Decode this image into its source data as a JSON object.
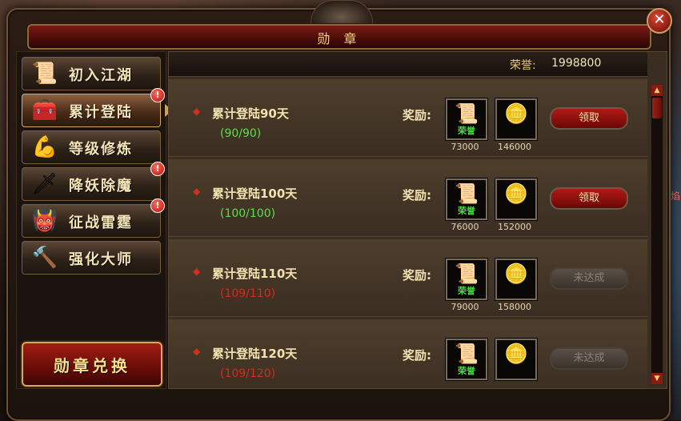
{
  "window": {
    "title": "勋 章",
    "close_glyph": "✕"
  },
  "sidebar": {
    "items": [
      {
        "label": "初入江湖",
        "icon": "scroll-icon",
        "glyph": "📜",
        "badge": false,
        "active": false
      },
      {
        "label": "累计登陆",
        "icon": "treasure-chest-icon",
        "glyph": "🧰",
        "badge": true,
        "active": true
      },
      {
        "label": "等级修炼",
        "icon": "warrior-icon",
        "glyph": "💪",
        "badge": false,
        "active": false
      },
      {
        "label": "降妖除魔",
        "icon": "sword-icon",
        "glyph": "🗡",
        "badge": true,
        "active": false
      },
      {
        "label": "征战雷霆",
        "icon": "demon-mask-icon",
        "glyph": "👹",
        "badge": true,
        "active": false
      },
      {
        "label": "强化大师",
        "icon": "hammer-icon",
        "glyph": "🔨",
        "badge": false,
        "active": false
      }
    ],
    "badge_glyph": "!",
    "exchange_label": "勋章兑换"
  },
  "honor": {
    "label": "荣誉:",
    "value": "1998800"
  },
  "rows": [
    {
      "title": "累计登陆90天",
      "progress": "(90/90)",
      "complete": true,
      "reward_label": "奖励:",
      "rewards": [
        {
          "icon": "honor-scroll-icon",
          "text": "荣誉",
          "qty": "73000"
        },
        {
          "icon": "gold-ingot-icon",
          "qty": "146000"
        }
      ],
      "button": "领取"
    },
    {
      "title": "累计登陆100天",
      "progress": "(100/100)",
      "complete": true,
      "reward_label": "奖励:",
      "rewards": [
        {
          "icon": "honor-scroll-icon",
          "text": "荣誉",
          "qty": "76000"
        },
        {
          "icon": "gold-ingot-icon",
          "qty": "152000"
        }
      ],
      "button": "领取"
    },
    {
      "title": "累计登陆110天",
      "progress": "(109/110)",
      "complete": false,
      "reward_label": "奖励:",
      "rewards": [
        {
          "icon": "honor-scroll-icon",
          "text": "荣誉",
          "qty": "79000"
        },
        {
          "icon": "gold-ingot-icon",
          "qty": "158000"
        }
      ],
      "button": "未达成"
    },
    {
      "title": "累计登陆120天",
      "progress": "(109/120)",
      "complete": false,
      "reward_label": "奖励:",
      "rewards": [
        {
          "icon": "honor-scroll-icon",
          "text": "荣誉"
        },
        {
          "icon": "gold-ingot-icon"
        }
      ],
      "button": "未达成"
    }
  ],
  "scroll": {
    "up": "▲",
    "down": "▼"
  },
  "edge_text": "焰"
}
